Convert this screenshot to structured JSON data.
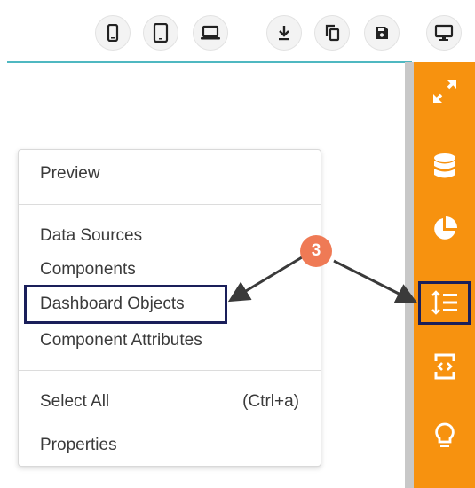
{
  "toolbar": {
    "buttons": [
      {
        "name": "mobile-view-button",
        "icon": "mobile-phone-icon"
      },
      {
        "name": "tablet-view-button",
        "icon": "tablet-icon"
      },
      {
        "name": "laptop-view-button",
        "icon": "laptop-icon"
      },
      {
        "name": "download-button",
        "icon": "download-icon"
      },
      {
        "name": "copy-button",
        "icon": "copy-icon"
      },
      {
        "name": "save-button",
        "icon": "save-icon"
      },
      {
        "name": "desktop-view-button",
        "icon": "desktop-monitor-icon"
      }
    ]
  },
  "context_menu": {
    "preview": "Preview",
    "data_sources": "Data Sources",
    "components": "Components",
    "dashboard_objects": "Dashboard Objects",
    "component_attributes": "Component Attributes",
    "select_all": "Select All",
    "select_all_shortcut": "(Ctrl+a)",
    "properties": "Properties"
  },
  "sidebar": {
    "items": [
      {
        "name": "expand",
        "icon": "expand-arrows-icon"
      },
      {
        "name": "data",
        "icon": "database-icon"
      },
      {
        "name": "charts",
        "icon": "pie-chart-icon"
      },
      {
        "name": "dashboard-objects",
        "icon": "list-order-icon"
      },
      {
        "name": "component-code",
        "icon": "code-icon"
      },
      {
        "name": "tips",
        "icon": "lightbulb-icon"
      }
    ]
  },
  "annotation": {
    "step": "3"
  },
  "colors": {
    "sidebar": "#f7920f",
    "highlight": "#1a1f5a",
    "badge": "#ef7a55",
    "accent_line": "#4fb8c1"
  }
}
